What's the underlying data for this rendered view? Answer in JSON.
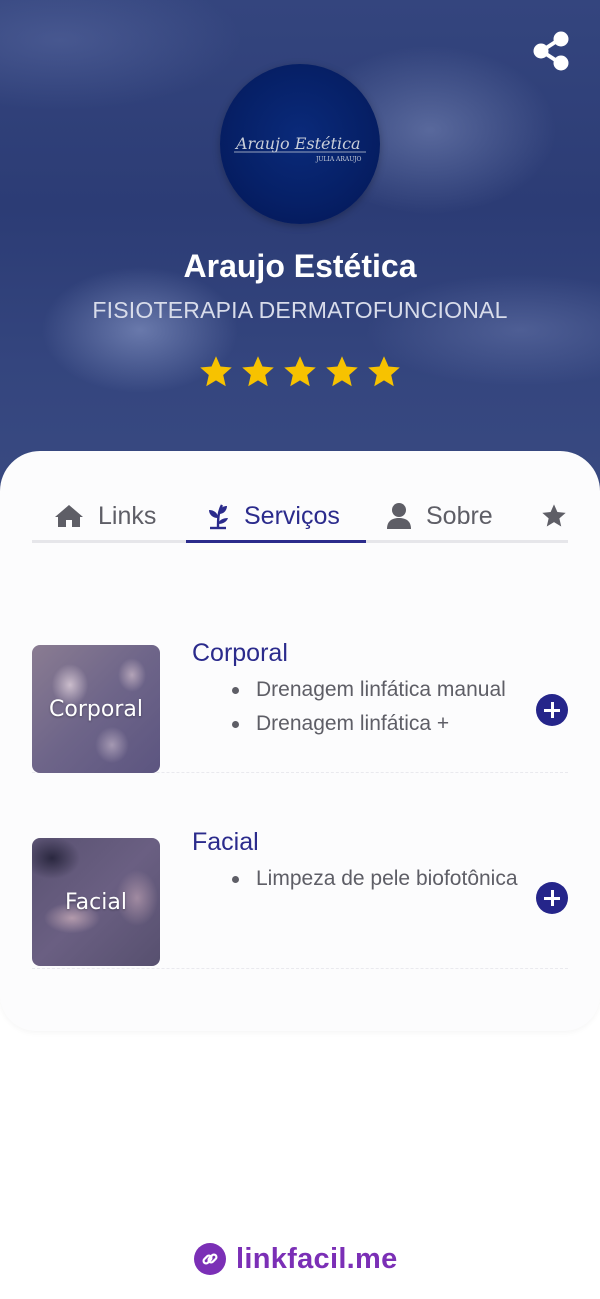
{
  "profile": {
    "name": "Araujo Estética",
    "subtitle": "FISIOTERAPIA DERMATOFUNCIONAL",
    "rating": 5,
    "logo_text": "Araujo Estética",
    "logo_subtext": "JULIA ARAUJO"
  },
  "tabs": [
    {
      "label": "Links",
      "icon": "home-icon"
    },
    {
      "label": "Serviços",
      "icon": "leaf-icon",
      "active": true
    },
    {
      "label": "Sobre",
      "icon": "user-icon"
    },
    {
      "label": "",
      "icon": "star-icon"
    }
  ],
  "services": [
    {
      "thumb_label": "Corporal",
      "title": "Corporal",
      "items": [
        "Drenagem linfática manual",
        "Drenagem linfática +"
      ]
    },
    {
      "thumb_label": "Facial",
      "title": "Facial",
      "items": [
        "Limpeza de pele biofotônica"
      ]
    }
  ],
  "footer": {
    "brand": "linkfacil.me"
  },
  "colors": {
    "accent": "#2b2b8c",
    "star": "#f7c200",
    "brand": "#7b2fb6"
  }
}
